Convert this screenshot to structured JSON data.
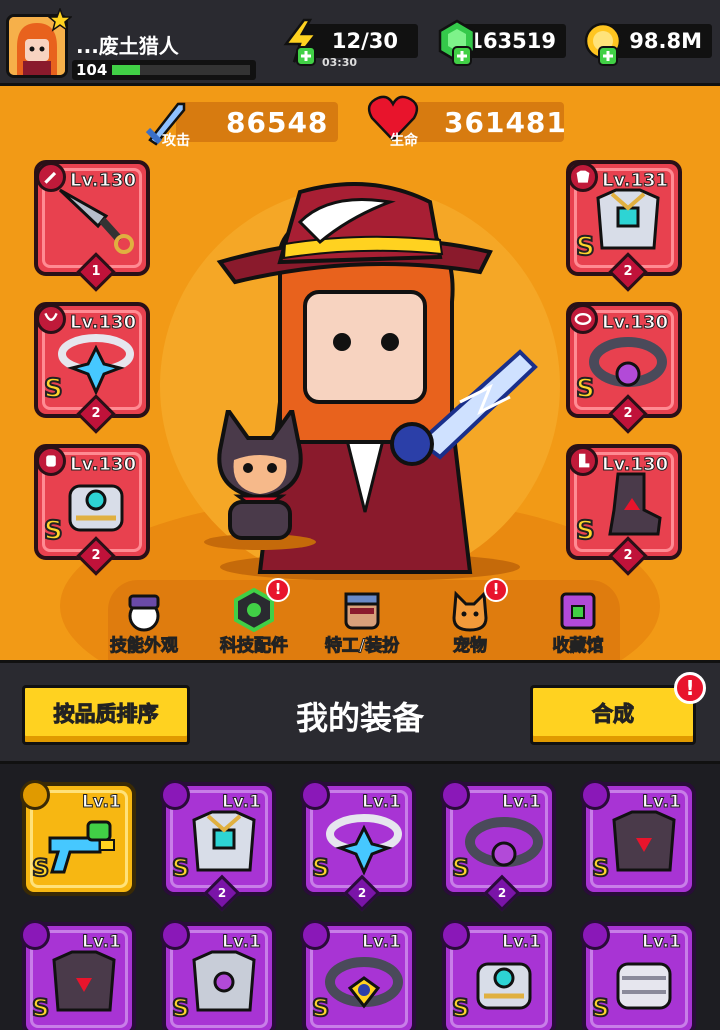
{
  "player": {
    "name": "...废土猎人",
    "level": "104",
    "xp_progress": 0.2
  },
  "resources": {
    "energy": {
      "value": "12/30",
      "timer": "03:30",
      "icon": "lightning-icon"
    },
    "gems": {
      "value": "163519",
      "icon": "green-gem-icon"
    },
    "coins": {
      "value": "98.8M",
      "icon": "gold-coin-icon"
    }
  },
  "stats": {
    "attack": {
      "label": "攻击",
      "value": "86548",
      "icon": "sword-icon"
    },
    "health": {
      "label": "生命",
      "value": "361481",
      "icon": "heart-icon"
    }
  },
  "equipped": {
    "left": [
      {
        "slot": "weapon",
        "level": "Lv.130",
        "rank": "",
        "stars": "1",
        "icon": "kunai-icon"
      },
      {
        "slot": "necklace",
        "level": "Lv.130",
        "rank": "S",
        "stars": "2",
        "icon": "star-necklace-icon"
      },
      {
        "slot": "gloves",
        "level": "Lv.130",
        "rank": "S",
        "stars": "2",
        "icon": "gauntlet-icon"
      }
    ],
    "right": [
      {
        "slot": "armor",
        "level": "Lv.131",
        "rank": "S",
        "stars": "2",
        "icon": "chest-armor-icon"
      },
      {
        "slot": "belt",
        "level": "Lv.130",
        "rank": "S",
        "stars": "2",
        "icon": "belt-icon"
      },
      {
        "slot": "boots",
        "level": "Lv.130",
        "rank": "S",
        "stars": "2",
        "icon": "boots-icon"
      }
    ]
  },
  "nav": [
    {
      "label": "技能外观",
      "icon": "skill-skin-icon",
      "badge": ""
    },
    {
      "label": "科技配件",
      "icon": "tech-part-icon",
      "badge": "!"
    },
    {
      "label": "特工/装扮",
      "icon": "agent-costume-icon",
      "badge": ""
    },
    {
      "label": "宠物",
      "icon": "pet-icon",
      "badge": "!"
    },
    {
      "label": "收藏馆",
      "icon": "collection-icon",
      "badge": ""
    }
  ],
  "actions": {
    "sort_label": "按品质排序",
    "title": "我的装备",
    "merge_label": "合成",
    "merge_badge": "!"
  },
  "inventory": [
    {
      "level": "Lv.1",
      "rank": "S",
      "stars": "",
      "rarity": "gold",
      "icon": "water-gun-icon"
    },
    {
      "level": "Lv.1",
      "rank": "S",
      "stars": "2",
      "rarity": "purple",
      "icon": "chest-armor-icon"
    },
    {
      "level": "Lv.1",
      "rank": "S",
      "stars": "2",
      "rarity": "purple",
      "icon": "star-necklace-icon"
    },
    {
      "level": "Lv.1",
      "rank": "S",
      "stars": "2",
      "rarity": "purple",
      "icon": "belt-icon"
    },
    {
      "level": "Lv.1",
      "rank": "S",
      "stars": "",
      "rarity": "purple",
      "icon": "dark-armor-icon"
    },
    {
      "level": "Lv.1",
      "rank": "S",
      "stars": "",
      "rarity": "purple",
      "icon": "dark-armor-icon"
    },
    {
      "level": "Lv.1",
      "rank": "S",
      "stars": "",
      "rarity": "purple",
      "icon": "silver-armor-icon"
    },
    {
      "level": "Lv.1",
      "rank": "S",
      "stars": "",
      "rarity": "purple",
      "icon": "gold-belt-icon"
    },
    {
      "level": "Lv.1",
      "rank": "S",
      "stars": "",
      "rarity": "purple",
      "icon": "gauntlet-icon"
    },
    {
      "level": "Lv.1",
      "rank": "S",
      "stars": "",
      "rarity": "purple",
      "icon": "silver-gauntlet-icon"
    }
  ],
  "colors": {
    "hero_bg": "#f29a16",
    "slot_red": "#e8414f",
    "item_purple": "#a834d4",
    "item_gold": "#f7b712",
    "button_yellow": "#ffd220"
  }
}
